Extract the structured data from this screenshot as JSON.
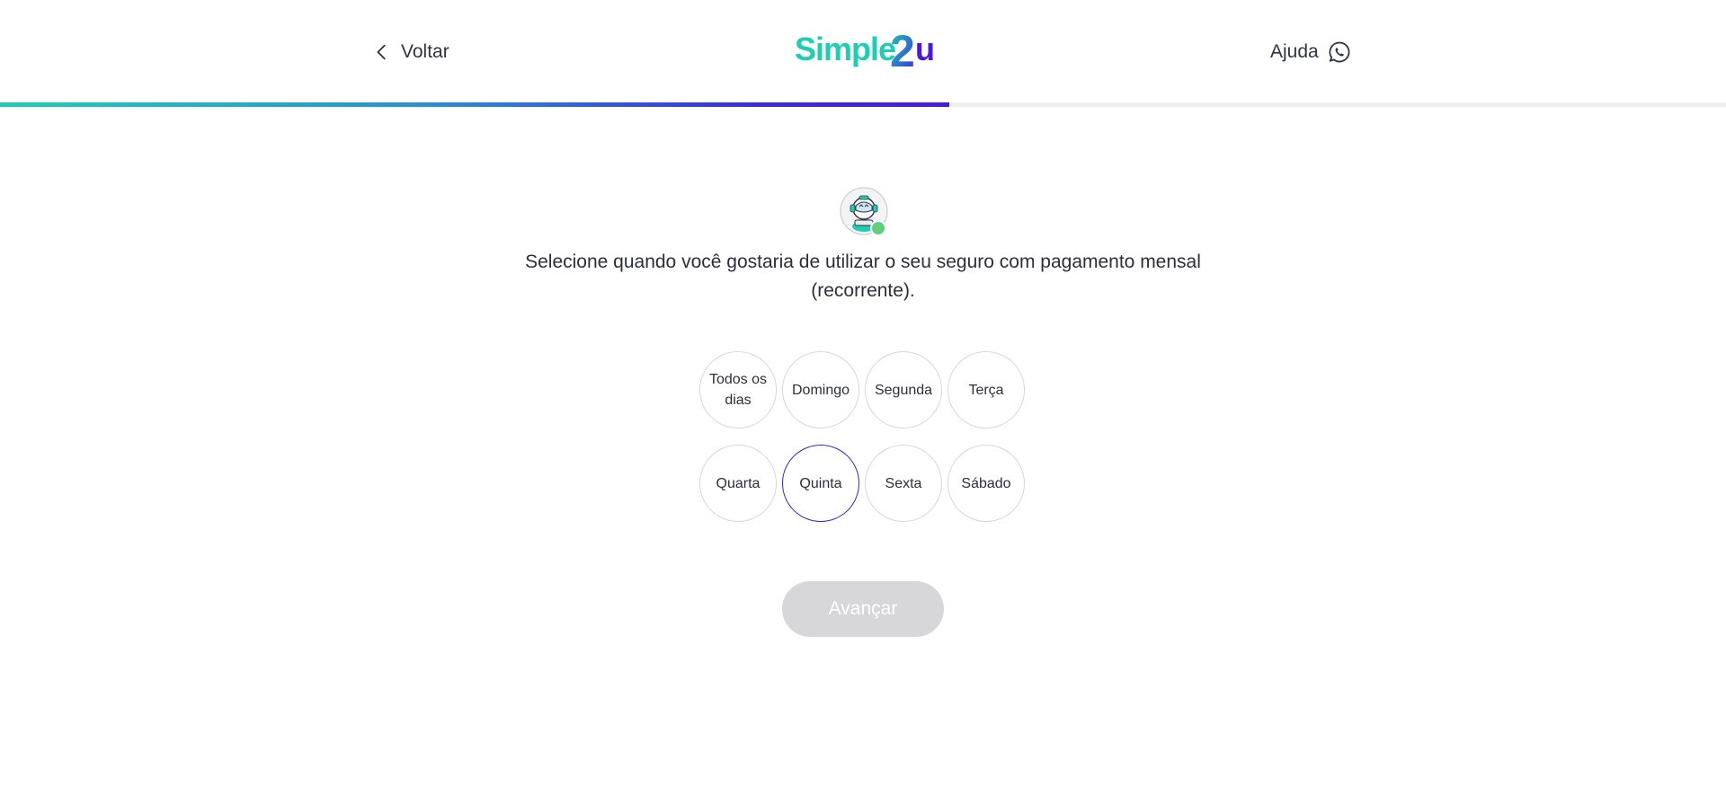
{
  "header": {
    "back_label": "Voltar",
    "logo_text": "Simple2u",
    "help_label": "Ajuda"
  },
  "progress": {
    "fraction": 0.55
  },
  "question": {
    "text": "Selecione quando você gostaria de utilizar o seu seguro com pagamento mensal (recorrente)."
  },
  "days": [
    {
      "label": "Todos os dias",
      "selected": false
    },
    {
      "label": "Domingo",
      "selected": false
    },
    {
      "label": "Segunda",
      "selected": false
    },
    {
      "label": "Terça",
      "selected": false
    },
    {
      "label": "Quarta",
      "selected": false
    },
    {
      "label": "Quinta",
      "selected": true
    },
    {
      "label": "Sexta",
      "selected": false
    },
    {
      "label": "Sábado",
      "selected": false
    }
  ],
  "advance_button": {
    "label": "Avançar",
    "disabled": true
  },
  "colors": {
    "accent": "#3a1fd8",
    "teal": "#1fcdb5",
    "online": "#5ed07a",
    "disabled_button": "#d7d7da"
  },
  "icons": {
    "back": "chevron-left-icon",
    "help": "whatsapp-icon",
    "assistant": "robot-avatar-icon"
  }
}
